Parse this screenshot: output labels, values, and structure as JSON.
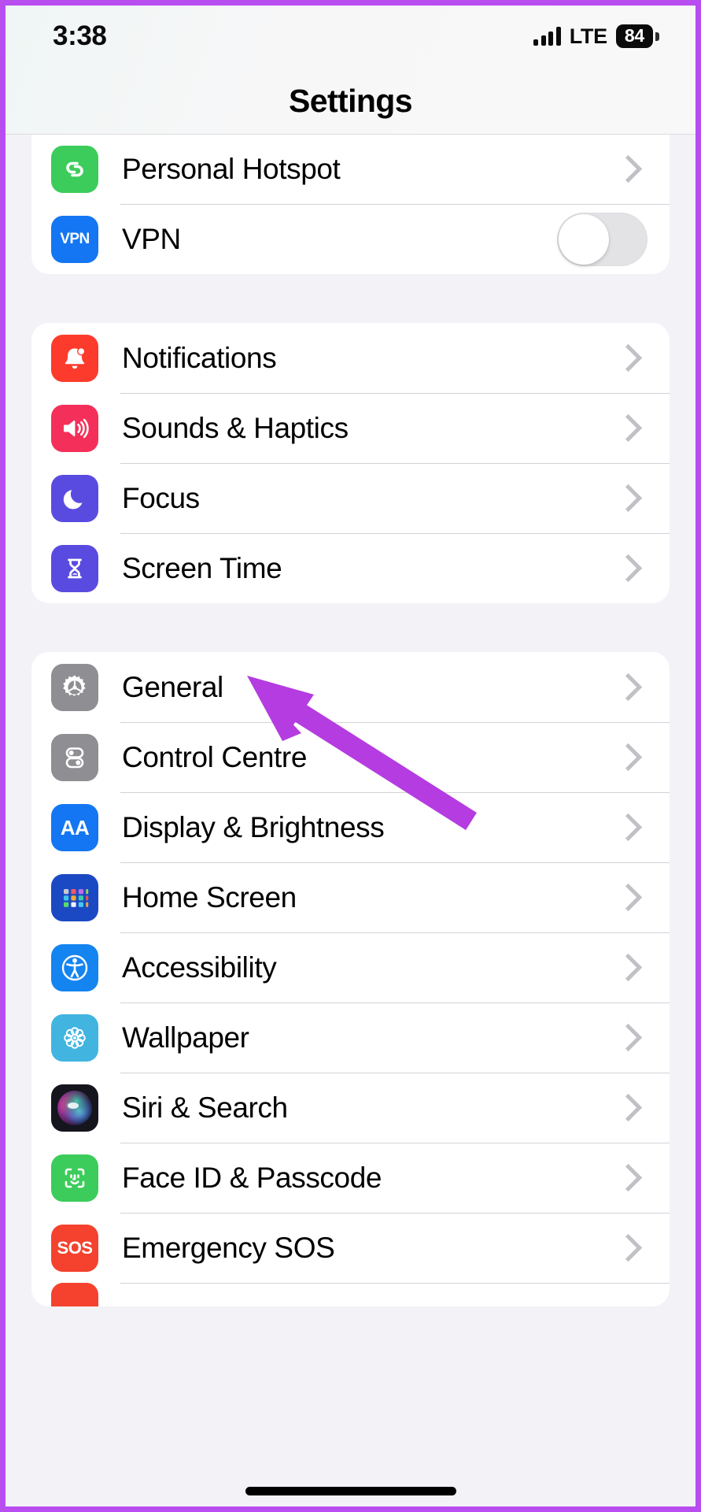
{
  "device": {
    "status_bar": {
      "time": "3:38",
      "network_label": "LTE",
      "battery_percent": "84",
      "signal_icon": "cellular-signal-icon"
    },
    "nav_title": "Settings",
    "home_indicator": "home-indicator"
  },
  "accent": {
    "annotation_arrow": "#b43ce0",
    "frame_border": "#b84df0",
    "page_background": "#f2f2f7",
    "card_background": "#ffffff",
    "separator": "#d2d2d6",
    "chevron": "#c0c0c5"
  },
  "groups": [
    {
      "id": "connectivity",
      "rows": [
        {
          "label": "Personal Hotspot",
          "icon": "personal-hotspot-icon",
          "icon_color": "#3ccc5b",
          "accessory": "chevron"
        },
        {
          "label": "VPN",
          "icon": "vpn-icon",
          "icon_color": "#1476f2",
          "icon_text": "VPN",
          "accessory": "toggle",
          "toggle_on": false
        }
      ]
    },
    {
      "id": "alerts",
      "rows": [
        {
          "label": "Notifications",
          "icon": "notifications-bell-icon",
          "icon_color": "#fc3b2d",
          "accessory": "chevron"
        },
        {
          "label": "Sounds & Haptics",
          "icon": "sounds-haptics-speaker-icon",
          "icon_color": "#f4305a",
          "accessory": "chevron"
        },
        {
          "label": "Focus",
          "icon": "focus-moon-icon",
          "icon_color": "#5a4be0",
          "accessory": "chevron"
        },
        {
          "label": "Screen Time",
          "icon": "screen-time-hourglass-icon",
          "icon_color": "#5a4be0",
          "accessory": "chevron"
        }
      ]
    },
    {
      "id": "system",
      "rows": [
        {
          "label": "General",
          "icon": "general-gear-icon",
          "icon_color": "#8e8e93",
          "accessory": "chevron"
        },
        {
          "label": "Control Centre",
          "icon": "control-centre-sliders-icon",
          "icon_color": "#8e8e93",
          "accessory": "chevron"
        },
        {
          "label": "Display & Brightness",
          "icon": "display-brightness-icon",
          "icon_color": "#1476f2",
          "icon_text": "AA",
          "accessory": "chevron"
        },
        {
          "label": "Home Screen",
          "icon": "home-screen-grid-icon",
          "icon_color": "#1b49c4",
          "accessory": "chevron"
        },
        {
          "label": "Accessibility",
          "icon": "accessibility-icon",
          "icon_color": "#1484f0",
          "accessory": "chevron"
        },
        {
          "label": "Wallpaper",
          "icon": "wallpaper-flower-icon",
          "icon_color": "#41b4e0",
          "accessory": "chevron"
        },
        {
          "label": "Siri & Search",
          "icon": "siri-orb-icon",
          "icon_color": "#1a1a22",
          "accessory": "chevron"
        },
        {
          "label": "Face ID & Passcode",
          "icon": "face-id-icon",
          "icon_color": "#3ccc5b",
          "accessory": "chevron"
        },
        {
          "label": "Emergency SOS",
          "icon": "emergency-sos-icon",
          "icon_color": "#f4422e",
          "icon_text": "SOS",
          "accessory": "chevron"
        }
      ]
    }
  ],
  "annotation": {
    "type": "arrow",
    "target_label": "General",
    "color": "#b43ce0"
  }
}
